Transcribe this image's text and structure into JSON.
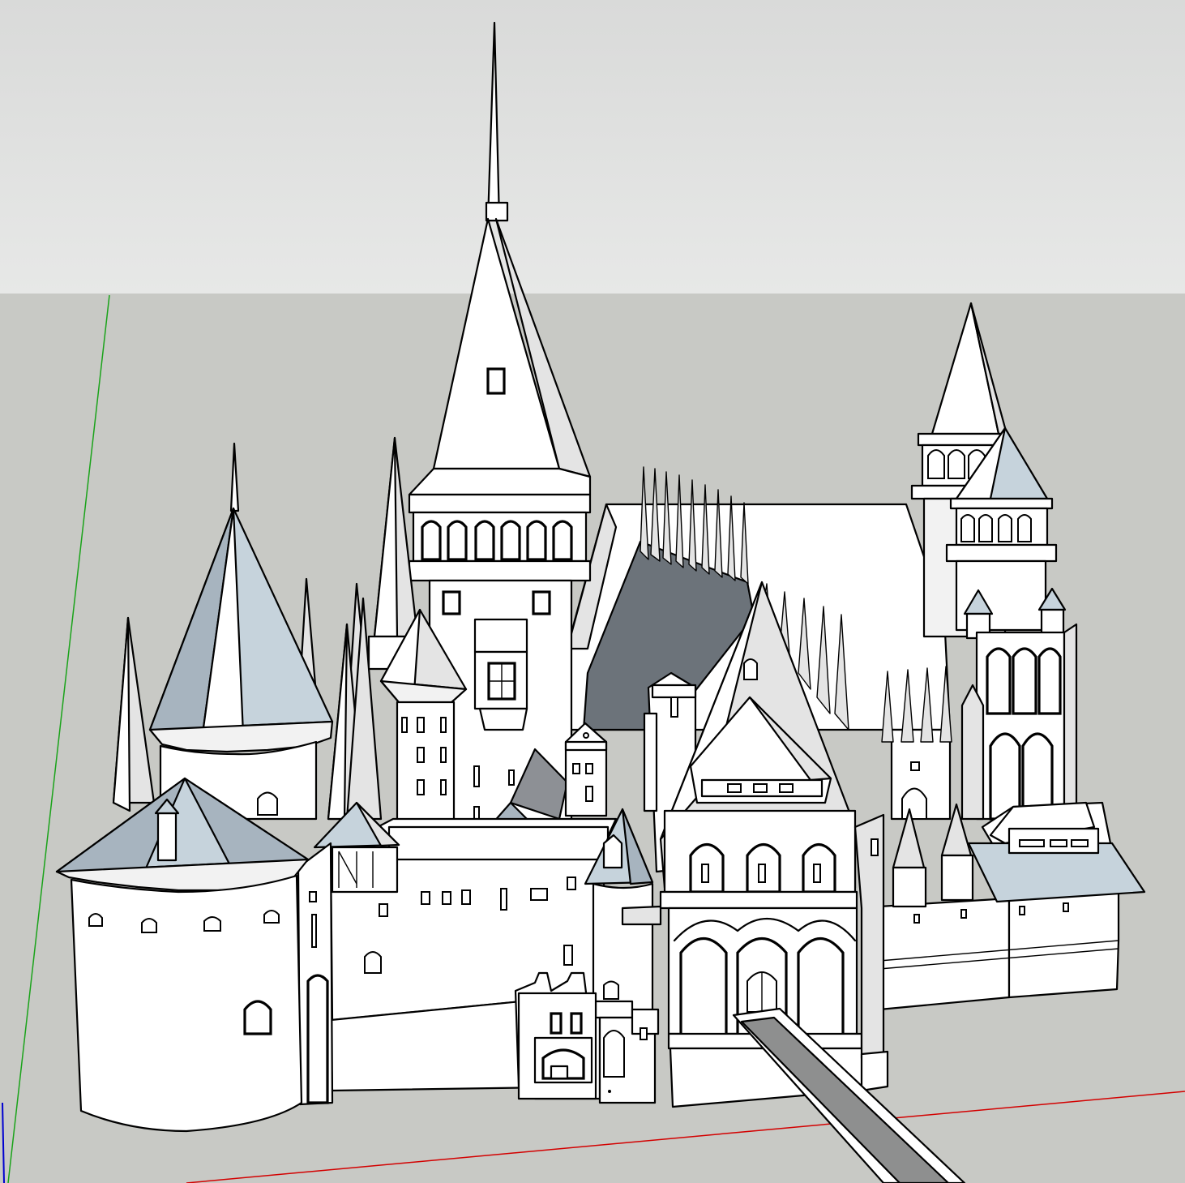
{
  "app": {
    "type": "3d-modeling-viewport",
    "model_description_shown": false
  },
  "viewport": {
    "sky_color": "#e7e8e7",
    "sky_color_top": "#d9dad9",
    "ground_color": "#c8c9c5",
    "axes": [
      {
        "name": "red-axis",
        "color": "#d30000"
      },
      {
        "name": "green-axis",
        "color": "#1aa31a"
      },
      {
        "name": "blue-axis",
        "color": "#0000d0"
      }
    ],
    "face_colors": {
      "front": "#ffffff",
      "shaded": "#e4e4e4",
      "roof_light": "#c6d3dc",
      "roof_mid": "#a7b4bf",
      "roof_dark": "#6c737a",
      "edge": "#000000"
    }
  }
}
